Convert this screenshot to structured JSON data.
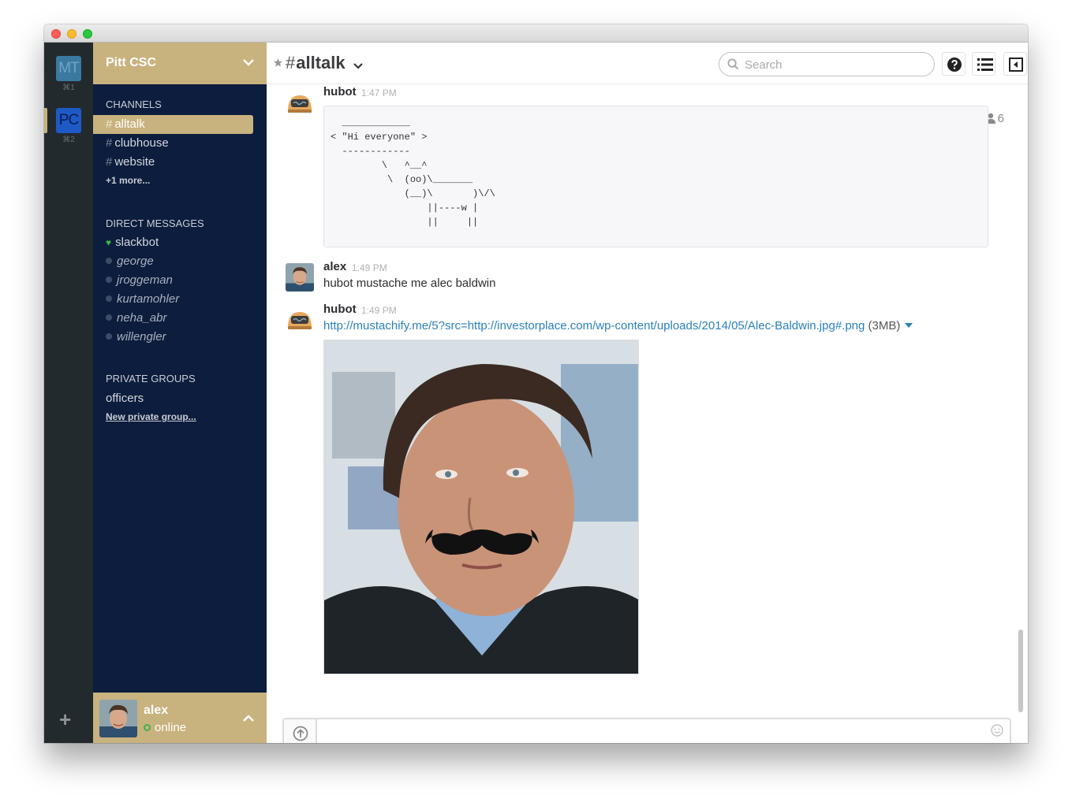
{
  "teams": [
    {
      "initials": "MT",
      "shortcut": "⌘1"
    },
    {
      "initials": "PC",
      "shortcut": "⌘2"
    }
  ],
  "add_team_label": "+",
  "sidebar": {
    "team_name": "Pitt CSC",
    "channels_title": "CHANNELS",
    "channels": [
      {
        "label": "alltalk",
        "active": true
      },
      {
        "label": "clubhouse"
      },
      {
        "label": "website"
      }
    ],
    "channels_more": "+1 more...",
    "dm_title": "DIRECT MESSAGES",
    "dms": [
      {
        "label": "slackbot",
        "status": "bot"
      },
      {
        "label": "george",
        "status": "away"
      },
      {
        "label": "jroggeman",
        "status": "away"
      },
      {
        "label": "kurtamohler",
        "status": "away"
      },
      {
        "label": "neha_abr",
        "status": "away"
      },
      {
        "label": "willengler",
        "status": "away"
      }
    ],
    "groups_title": "PRIVATE GROUPS",
    "groups": [
      {
        "label": "officers"
      }
    ],
    "new_group": "New private group...",
    "user": {
      "name": "alex",
      "status": "online"
    }
  },
  "header": {
    "hash": "#",
    "channel": "alltalk",
    "search_placeholder": "Search",
    "member_count": "6"
  },
  "messages": [
    {
      "author": "hubot",
      "time": "1:47 PM",
      "code": "  ____________\n< \"Hi everyone\" >\n  ------------\n         \\   ^__^\n          \\  (oo)\\_______\n             (__)\\       )\\/\\\n                 ||----w |\n                 ||     ||"
    },
    {
      "author": "alex",
      "time": "1:49 PM",
      "text": "hubot mustache me alec baldwin"
    },
    {
      "author": "hubot",
      "time": "1:49 PM",
      "link": "http://mustachify.me/5?src=http://investorplace.com/wp-content/uploads/2014/05/Alec-Baldwin.jpg#.png",
      "size": "(3MB)"
    }
  ],
  "composer": {
    "placeholder": ""
  },
  "colors": {
    "sidebar_bg": "#0c1d3d",
    "accent": "#c8b27e",
    "link": "#2a80b9",
    "online": "#3fb34f"
  }
}
